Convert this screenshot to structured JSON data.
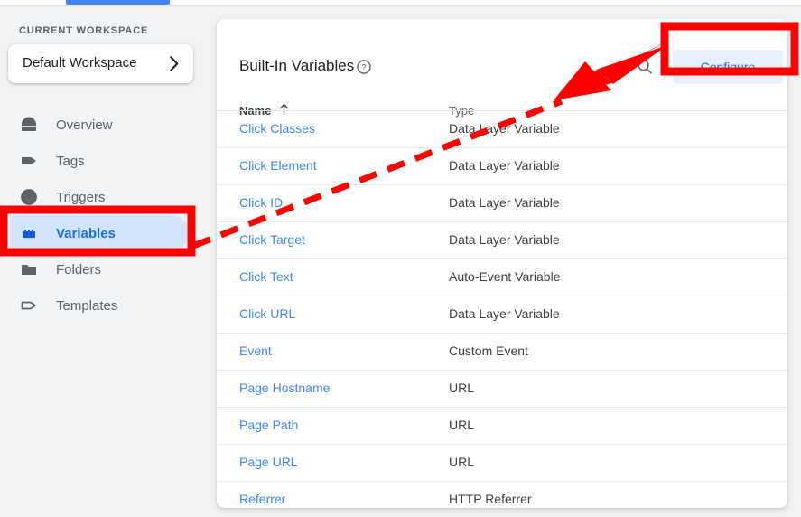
{
  "sidebar": {
    "workspace_section_label": "CURRENT WORKSPACE",
    "workspace_name": "Default Workspace",
    "chevron_icon": "chevron-right-icon",
    "items": [
      {
        "label": "Overview",
        "icon": "overview-icon",
        "active": false
      },
      {
        "label": "Tags",
        "icon": "tag-icon",
        "active": false
      },
      {
        "label": "Triggers",
        "icon": "trigger-icon",
        "active": false
      },
      {
        "label": "Variables",
        "icon": "variables-icon",
        "active": true
      },
      {
        "label": "Folders",
        "icon": "folder-icon",
        "active": false
      },
      {
        "label": "Templates",
        "icon": "template-icon",
        "active": false
      }
    ]
  },
  "card": {
    "title": "Built-In Variables",
    "help_icon": "help-circle-icon",
    "search_icon": "search-icon",
    "configure_label": "Configure",
    "columns": {
      "name": "Name",
      "name_sort": "ascending",
      "sort_icon": "arrow-up-icon",
      "type": "Type"
    },
    "rows": [
      {
        "name": "Click Classes",
        "type": "Data Layer Variable"
      },
      {
        "name": "Click Element",
        "type": "Data Layer Variable"
      },
      {
        "name": "Click ID",
        "type": "Data Layer Variable"
      },
      {
        "name": "Click Target",
        "type": "Data Layer Variable"
      },
      {
        "name": "Click Text",
        "type": "Auto-Event Variable"
      },
      {
        "name": "Click URL",
        "type": "Data Layer Variable"
      },
      {
        "name": "Event",
        "type": "Custom Event"
      },
      {
        "name": "Page Hostname",
        "type": "URL"
      },
      {
        "name": "Page Path",
        "type": "URL"
      },
      {
        "name": "Page URL",
        "type": "URL"
      },
      {
        "name": "Referrer",
        "type": "HTTP Referrer"
      }
    ]
  },
  "annotations": {
    "color": "#FF0000",
    "highlight_variables": "red-rectangle-around-variables-nav-item",
    "highlight_configure": "red-rectangle-around-configure-button",
    "arrow": "red-dashed-arrow-from-variables-to-configure"
  },
  "colors": {
    "page_background": "#f1f3f4",
    "card_background": "#ffffff",
    "accent_blue": "#1a73e8",
    "link_blue": "#4285f4",
    "active_pill": "#d2e3fc",
    "button_background": "#e8f0fe",
    "annotation_red": "#FF0000",
    "tab_indicator": "#4285f4"
  }
}
